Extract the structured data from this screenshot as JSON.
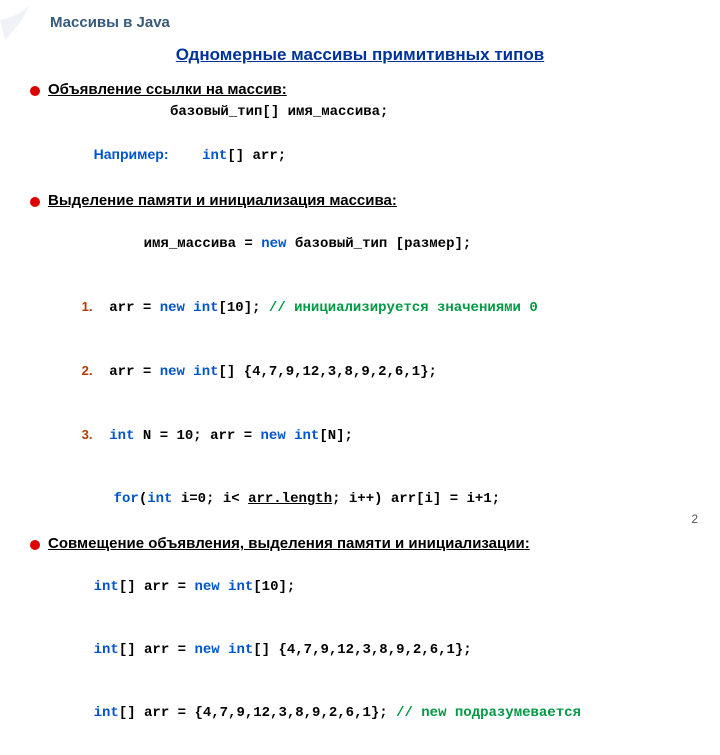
{
  "topic": "Массивы в Java",
  "title": "Одномерные массивы примитивных типов",
  "section1": {
    "label": "Объявление ссылки на массив",
    "syntax": "базовый_тип[] имя_массива;",
    "example_label": "Например:",
    "example_code": "int[] arr;"
  },
  "section2": {
    "label": "Выделение памяти и инициализация массива",
    "syntax": "имя_массива = new базовый_тип [размер];",
    "items": [
      {
        "n": "1.",
        "code_pre": "arr = ",
        "kw": "new int",
        "code_post": "[10]; ",
        "comment": "// инициализируется значениями 0"
      },
      {
        "n": "2.",
        "code_pre": "arr = ",
        "kw": "new int",
        "code_post": "[] {4,7,9,12,3,8,9,2,6,1};"
      },
      {
        "n": "3.",
        "kw1": "int",
        "code1": " N = 10; arr = ",
        "kw2": "new int",
        "code2": "[N];"
      }
    ],
    "for_line": {
      "kw1": "for",
      "t1": "(",
      "kw2": "int",
      "t2": " i=0; i< ",
      "u": "arr.length",
      "t3": "; i++) arr[i] = i+1;"
    }
  },
  "section3": {
    "label": "Совмещение объявления, выделения памяти и инициализации",
    "lines": [
      {
        "kw1": "int",
        "t1": "[] arr = ",
        "kw2": "new int",
        "t2": "[10];"
      },
      {
        "kw1": "int",
        "t1": "[] arr = ",
        "kw2": "new int",
        "t2": "[] {4,7,9,12,3,8,9,2,6,1};"
      },
      {
        "kw1": "int",
        "t1": "[] arr = {4,7,9,12,3,8,9,2,6,1}; ",
        "comment": "// new подразумевается"
      }
    ]
  },
  "page": "2"
}
